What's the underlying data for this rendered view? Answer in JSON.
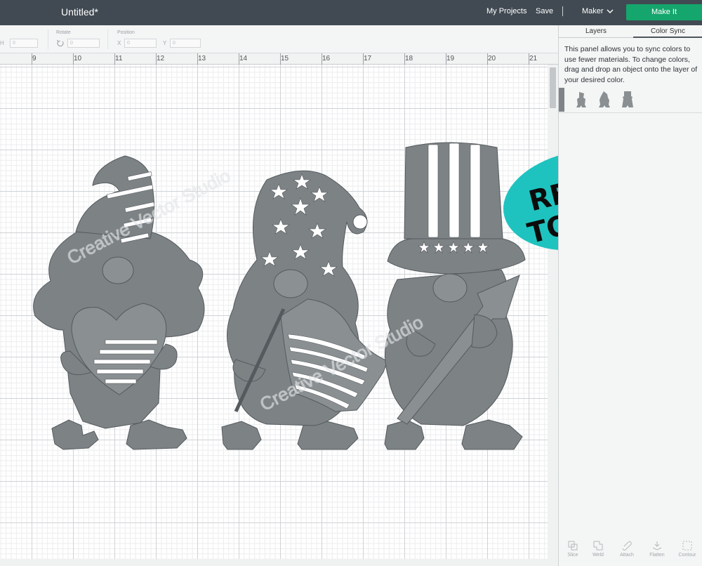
{
  "app": {
    "doc_title": "Untitled*"
  },
  "header": {
    "my_projects": "My Projects",
    "save": "Save",
    "separator": "|",
    "machine": "Maker",
    "make_it": "Make It",
    "make_it_color": "#14a66c"
  },
  "toolbar": {
    "h_label": "H",
    "h_value": "0",
    "rotate_label": "Rotate",
    "rotate_value": "0",
    "position_label": "Position",
    "x_label": "X",
    "x_value": "0",
    "y_label": "Y",
    "y_value": "0"
  },
  "ruler": {
    "ticks": [
      "9",
      "10",
      "11",
      "12",
      "13",
      "14",
      "15",
      "16",
      "17",
      "18",
      "19",
      "20",
      "21"
    ]
  },
  "panel": {
    "tabs": [
      "Layers",
      "Color Sync"
    ],
    "active_tab": "Color Sync",
    "description": "This panel allows you to sync colors to use fewer materials. To change colors, drag and drop an object onto the layer of your desired color.",
    "swatch_color": "#808487",
    "tools": [
      "Slice",
      "Weld",
      "Attach",
      "Flatten",
      "Contour"
    ]
  },
  "badge": {
    "line1": "READY",
    "line2": "TO CUT",
    "color": "#1ec3bf"
  },
  "artwork": {
    "fill": "#7d8285",
    "watermark": "Creative Vector Studio"
  }
}
